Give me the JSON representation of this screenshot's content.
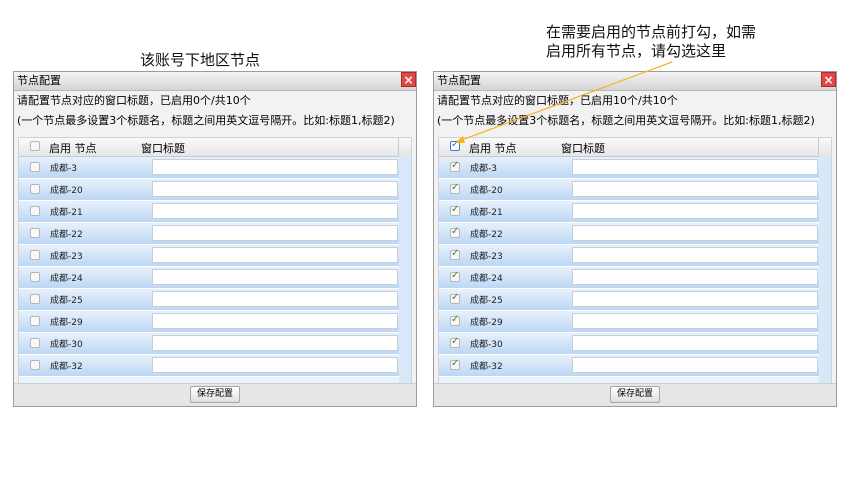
{
  "captions": {
    "left": "该账号下地区节点",
    "right_line1": "在需要启用的节点前打勾，如需",
    "right_line2": "启用所有节点，请勾选这里"
  },
  "colors": {
    "annotation_arrow": "#f2b61d",
    "close_button": "#e14848"
  },
  "panels": [
    {
      "title": "节点配置",
      "close_icon": "×",
      "info_line1": "请配置节点对应的窗口标题，已启用0个/共10个",
      "info_line2": "(一个节点最多设置3个标题名，标题之间用英文逗号隔开。比如:标题1,标题2)",
      "header_enable": "启用 节点",
      "header_title": "窗口标题",
      "header_checked": false,
      "rows": [
        {
          "name": "成都-3",
          "checked": false,
          "title": ""
        },
        {
          "name": "成都-20",
          "checked": false,
          "title": ""
        },
        {
          "name": "成都-21",
          "checked": false,
          "title": ""
        },
        {
          "name": "成都-22",
          "checked": false,
          "title": ""
        },
        {
          "name": "成都-23",
          "checked": false,
          "title": ""
        },
        {
          "name": "成都-24",
          "checked": false,
          "title": ""
        },
        {
          "name": "成都-25",
          "checked": false,
          "title": ""
        },
        {
          "name": "成都-29",
          "checked": false,
          "title": ""
        },
        {
          "name": "成都-30",
          "checked": false,
          "title": ""
        },
        {
          "name": "成都-32",
          "checked": false,
          "title": ""
        }
      ],
      "save_label": "保存配置"
    },
    {
      "title": "节点配置",
      "close_icon": "×",
      "info_line1": "请配置节点对应的窗口标题，已启用10个/共10个",
      "info_line2": "(一个节点最多设置3个标题名，标题之间用英文逗号隔开。比如:标题1,标题2)",
      "header_enable": "启用 节点",
      "header_title": "窗口标题",
      "header_checked": true,
      "rows": [
        {
          "name": "成都-3",
          "checked": true,
          "title": ""
        },
        {
          "name": "成都-20",
          "checked": true,
          "title": ""
        },
        {
          "name": "成都-21",
          "checked": true,
          "title": ""
        },
        {
          "name": "成都-22",
          "checked": true,
          "title": ""
        },
        {
          "name": "成都-23",
          "checked": true,
          "title": ""
        },
        {
          "name": "成都-24",
          "checked": true,
          "title": ""
        },
        {
          "name": "成都-25",
          "checked": true,
          "title": ""
        },
        {
          "name": "成都-29",
          "checked": true,
          "title": ""
        },
        {
          "name": "成都-30",
          "checked": true,
          "title": ""
        },
        {
          "name": "成都-32",
          "checked": true,
          "title": ""
        }
      ],
      "save_label": "保存配置"
    }
  ]
}
